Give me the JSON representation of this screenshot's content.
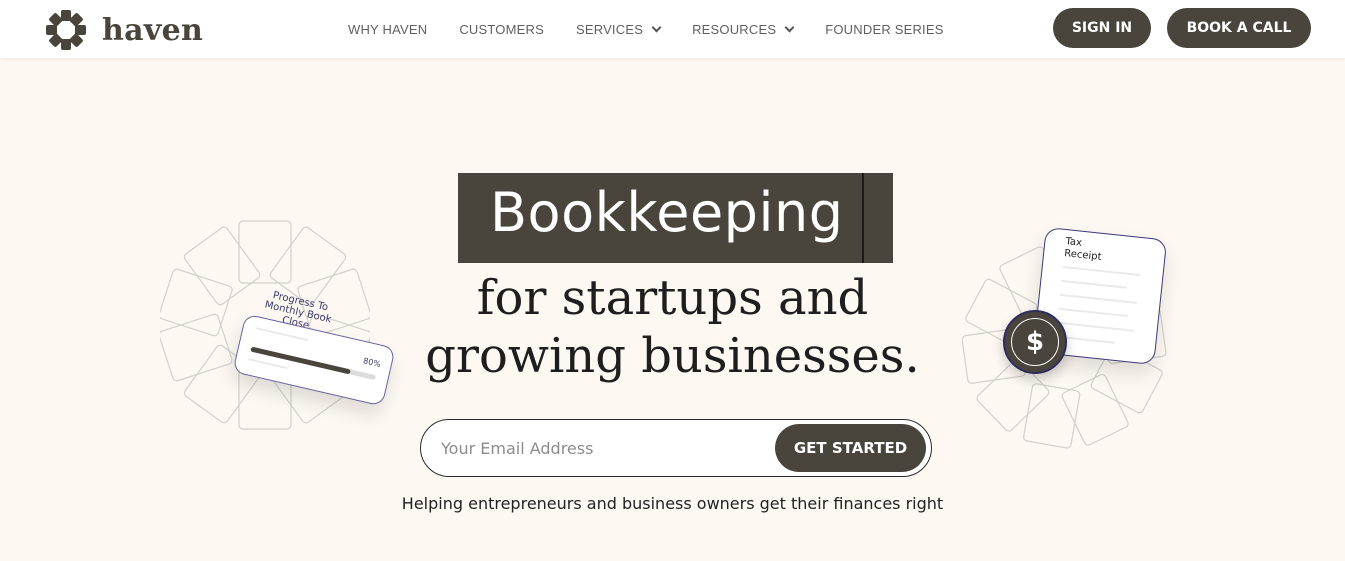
{
  "brand": {
    "name": "haven",
    "logo_icon": "flower-logo-icon"
  },
  "nav": {
    "items": [
      {
        "label": "WHY HAVEN",
        "has_dropdown": false
      },
      {
        "label": "CUSTOMERS",
        "has_dropdown": false
      },
      {
        "label": "SERVICES",
        "has_dropdown": true
      },
      {
        "label": "RESOURCES",
        "has_dropdown": true
      },
      {
        "label": "FOUNDER SERIES",
        "has_dropdown": false
      }
    ],
    "sign_in_label": "SIGN IN",
    "book_call_label": "BOOK A CALL"
  },
  "hero": {
    "headline_highlight": "Bookkeeping",
    "headline_line1": "for startups and",
    "headline_line2": "growing businesses.",
    "email_placeholder": "Your Email Address",
    "cta_label": "GET STARTED",
    "tagline": "Helping entrepreneurs and business owners get their finances right"
  },
  "illustrations": {
    "progress_card": {
      "title_line1": "Progress To",
      "title_line2": "Monthly Book",
      "title_line3": "Close",
      "percent_label": "80%",
      "progress_fraction": 0.8
    },
    "receipt_card": {
      "title_line1": "Tax",
      "title_line2": "Receipt",
      "coin_icon": "dollar-icon",
      "coin_symbol": "$"
    }
  },
  "colors": {
    "primary": "#4a453c",
    "background": "#fdf8f2",
    "accent_outline": "#3c3a78"
  }
}
